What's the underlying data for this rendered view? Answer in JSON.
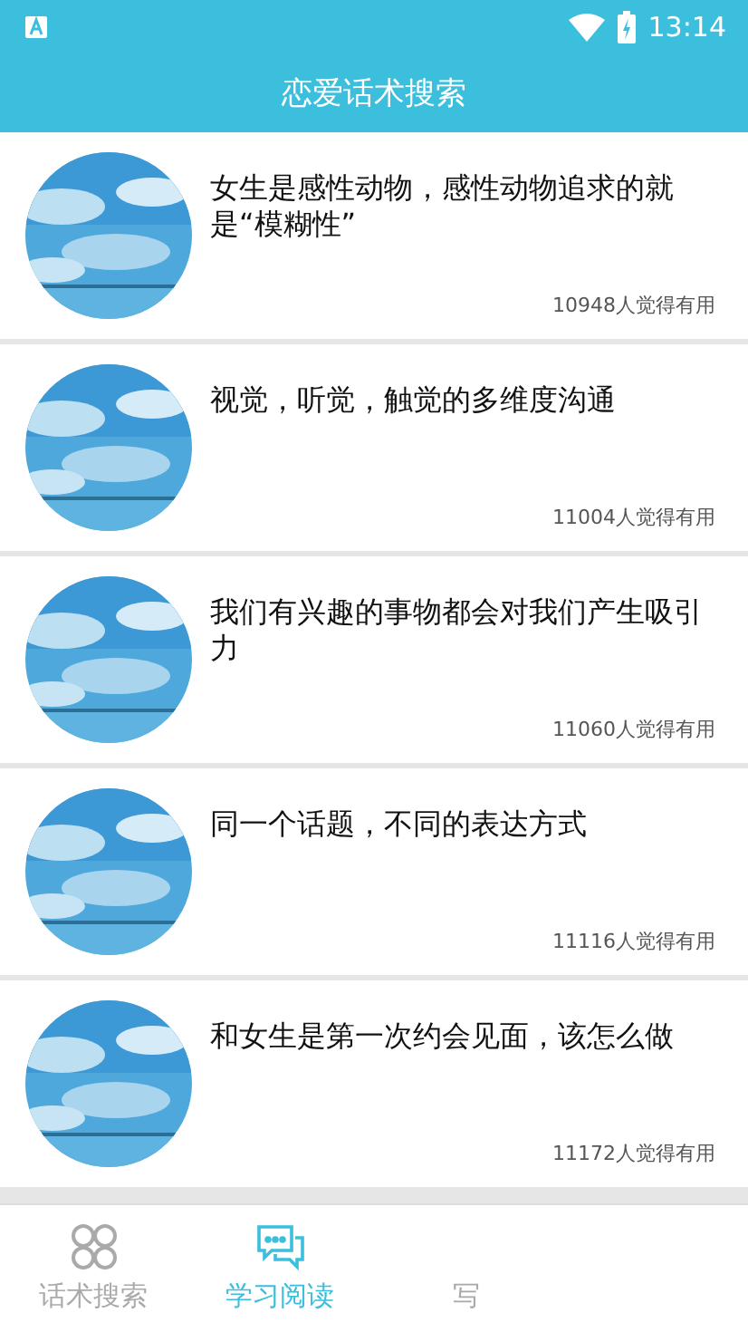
{
  "status_bar": {
    "time": "13:14"
  },
  "title": "恋爱话术搜索",
  "articles": [
    {
      "kind": "picture",
      "title": "女生是感性动物，感性动物追求的就是“模糊性”",
      "useful": "10948人觉得有用"
    },
    {
      "kind": "picture",
      "title": "视觉，听觉，触觉的多维度沟通",
      "useful": "11004人觉得有用"
    },
    {
      "kind": "picture",
      "title": "我们有兴趣的事物都会对我们产生吸引力",
      "useful": "11060人觉得有用"
    },
    {
      "kind": "picture",
      "title": "同一个话题，不同的表达方式",
      "useful": "11116人觉得有用"
    },
    {
      "kind": "picture",
      "title": "和女生是第一次约会见面，该怎么做",
      "useful": "11172人觉得有用"
    }
  ],
  "tabs": [
    {
      "label": "话术搜索",
      "kind": "grid",
      "selected": false
    },
    {
      "label": "学习阅读",
      "kind": "chat",
      "selected": true
    },
    {
      "label": "写",
      "kind": "plain",
      "selected": false
    }
  ]
}
